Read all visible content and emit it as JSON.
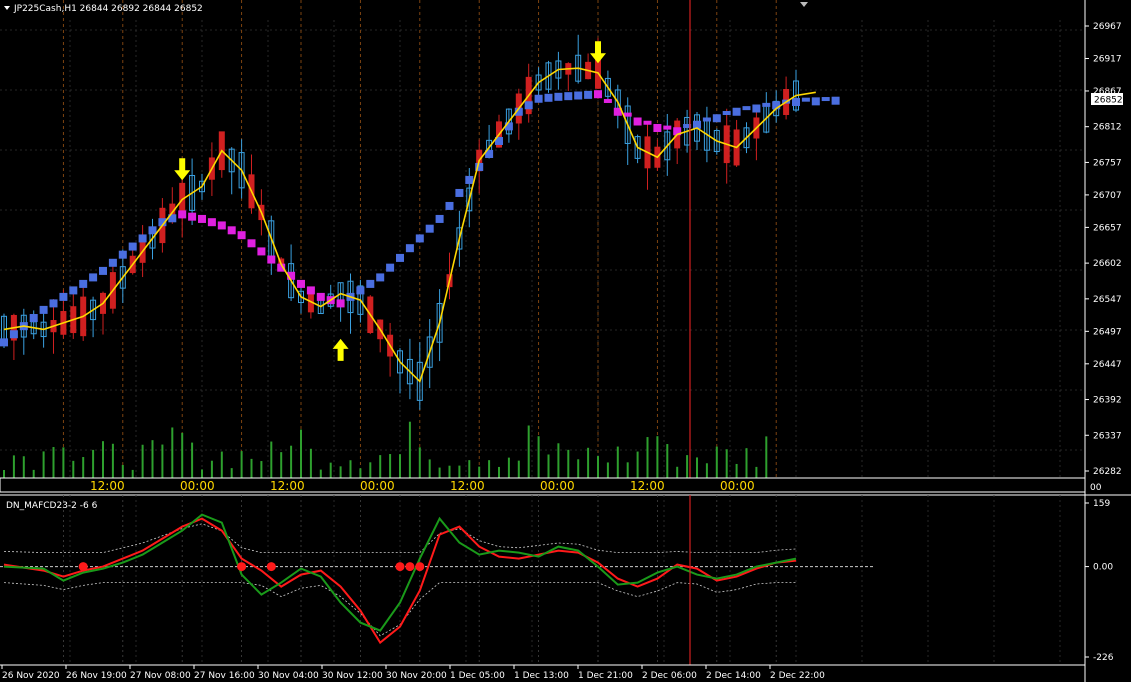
{
  "window": {
    "symbol_title": "JP225Cash,H1",
    "ohlc": "26844 26892 26844 26852",
    "indicator_title": "DN_MAFCD23-2 -6 6"
  },
  "colors": {
    "background": "#000000",
    "bull_candle": "#3aa0e0",
    "bear_candle": "#d02020",
    "volume": "#2ea02e",
    "trend_up": "#4a6ee0",
    "trend_down": "#e020e0",
    "fast_ma": "#ffd800",
    "signal_arrow": "#ffff00",
    "cursor_line": "#d02020",
    "osc_red": "#ff1a1a",
    "osc_green": "#1a9a1a"
  },
  "chart_data": [
    {
      "type": "candlestick",
      "symbol": "JP225Cash",
      "timeframe": "H1",
      "ylim": [
        26282,
        26967
      ],
      "y_ticks": [
        26967,
        26917,
        26867,
        26812,
        26757,
        26707,
        26657,
        26602,
        26547,
        26497,
        26447,
        26392,
        26337,
        26282
      ],
      "current_price": 26852,
      "session_labels": [
        "12:00",
        "00:00",
        "12:00",
        "00:00",
        "12:00",
        "00:00",
        "12:00",
        "00:00"
      ],
      "trend_line": [
        [
          0,
          26480
        ],
        [
          2,
          26505
        ],
        [
          4,
          26530
        ],
        [
          6,
          26550
        ],
        [
          8,
          26570
        ],
        [
          10,
          26590
        ],
        [
          12,
          26615
        ],
        [
          14,
          26640
        ],
        [
          16,
          26665
        ],
        [
          18,
          26677
        ],
        [
          20,
          26670
        ],
        [
          22,
          26660
        ],
        [
          24,
          26645
        ],
        [
          26,
          26620
        ],
        [
          28,
          26595
        ],
        [
          30,
          26570
        ],
        [
          32,
          26550
        ],
        [
          34,
          26540
        ],
        [
          36,
          26560
        ],
        [
          38,
          26580
        ],
        [
          40,
          26610
        ],
        [
          42,
          26640
        ],
        [
          44,
          26670
        ],
        [
          46,
          26710
        ],
        [
          48,
          26750
        ],
        [
          50,
          26790
        ],
        [
          52,
          26835
        ],
        [
          54,
          26855
        ],
        [
          56,
          26858
        ],
        [
          58,
          26860
        ],
        [
          60,
          26862
        ],
        [
          62,
          26835
        ],
        [
          64,
          26820
        ],
        [
          66,
          26810
        ],
        [
          68,
          26805
        ],
        [
          70,
          26815
        ],
        [
          72,
          26825
        ],
        [
          74,
          26835
        ],
        [
          76,
          26840
        ],
        [
          78,
          26845
        ],
        [
          80,
          26850
        ],
        [
          84,
          26852
        ]
      ],
      "fast_ma": [
        [
          0,
          26500
        ],
        [
          2,
          26505
        ],
        [
          4,
          26500
        ],
        [
          6,
          26510
        ],
        [
          8,
          26520
        ],
        [
          10,
          26540
        ],
        [
          12,
          26580
        ],
        [
          14,
          26620
        ],
        [
          16,
          26660
        ],
        [
          18,
          26700
        ],
        [
          20,
          26720
        ],
        [
          22,
          26775
        ],
        [
          24,
          26745
        ],
        [
          26,
          26680
        ],
        [
          28,
          26600
        ],
        [
          30,
          26550
        ],
        [
          32,
          26535
        ],
        [
          34,
          26555
        ],
        [
          36,
          26545
        ],
        [
          38,
          26500
        ],
        [
          40,
          26450
        ],
        [
          42,
          26420
        ],
        [
          44,
          26510
        ],
        [
          46,
          26640
        ],
        [
          48,
          26760
        ],
        [
          50,
          26800
        ],
        [
          52,
          26840
        ],
        [
          54,
          26880
        ],
        [
          56,
          26900
        ],
        [
          58,
          26902
        ],
        [
          60,
          26895
        ],
        [
          62,
          26850
        ],
        [
          64,
          26780
        ],
        [
          66,
          26765
        ],
        [
          68,
          26800
        ],
        [
          70,
          26810
        ],
        [
          72,
          26790
        ],
        [
          74,
          26780
        ],
        [
          76,
          26810
        ],
        [
          78,
          26840
        ],
        [
          80,
          26860
        ],
        [
          82,
          26865
        ]
      ],
      "signals": [
        {
          "type": "down",
          "index": 18,
          "value": 26745
        },
        {
          "type": "up",
          "index": 34,
          "value": 26470
        },
        {
          "type": "down",
          "index": 60,
          "value": 26925
        }
      ]
    },
    {
      "type": "line",
      "name": "DN_MAFCD23-2",
      "ylim": [
        -226,
        159
      ],
      "y_ticks": [
        159,
        0.0,
        -226
      ],
      "y_tick_labels": [
        "159",
        "0.00",
        "-226"
      ],
      "x_labels": [
        "26 Nov 2020",
        "26 Nov 19:00",
        "27 Nov 08:00",
        "27 Nov 16:00",
        "30 Nov 04:00",
        "30 Nov 12:00",
        "30 Nov 20:00",
        "1 Dec 05:00",
        "1 Dec 13:00",
        "1 Dec 21:00",
        "2 Dec 06:00",
        "2 Dec 14:00",
        "2 Dec 22:00"
      ],
      "series": [
        {
          "values": [
            [
              0,
              5
            ],
            [
              4,
              -10
            ],
            [
              6,
              -25
            ],
            [
              8,
              -10
            ],
            [
              10,
              0
            ],
            [
              12,
              20
            ],
            [
              14,
              40
            ],
            [
              16,
              70
            ],
            [
              18,
              100
            ],
            [
              20,
              120
            ],
            [
              22,
              90
            ],
            [
              24,
              20
            ],
            [
              26,
              -10
            ],
            [
              28,
              -50
            ],
            [
              30,
              -20
            ],
            [
              32,
              -10
            ],
            [
              34,
              -50
            ],
            [
              36,
              -110
            ],
            [
              38,
              -190
            ],
            [
              40,
              -150
            ],
            [
              42,
              -60
            ],
            [
              44,
              80
            ],
            [
              46,
              100
            ],
            [
              48,
              50
            ],
            [
              50,
              25
            ],
            [
              52,
              20
            ],
            [
              54,
              30
            ],
            [
              56,
              40
            ],
            [
              58,
              35
            ],
            [
              60,
              10
            ],
            [
              62,
              -30
            ],
            [
              64,
              -50
            ],
            [
              66,
              -30
            ],
            [
              68,
              5
            ],
            [
              70,
              -5
            ],
            [
              72,
              -35
            ],
            [
              74,
              -25
            ],
            [
              76,
              -5
            ],
            [
              78,
              10
            ],
            [
              80,
              15
            ]
          ]
        },
        {
          "values": [
            [
              0,
              0
            ],
            [
              4,
              -5
            ],
            [
              6,
              -35
            ],
            [
              8,
              -15
            ],
            [
              10,
              -5
            ],
            [
              12,
              10
            ],
            [
              14,
              30
            ],
            [
              16,
              60
            ],
            [
              18,
              90
            ],
            [
              20,
              130
            ],
            [
              22,
              110
            ],
            [
              24,
              -20
            ],
            [
              26,
              -70
            ],
            [
              28,
              -40
            ],
            [
              30,
              -5
            ],
            [
              32,
              -25
            ],
            [
              34,
              -90
            ],
            [
              36,
              -140
            ],
            [
              38,
              -160
            ],
            [
              40,
              -90
            ],
            [
              42,
              20
            ],
            [
              44,
              120
            ],
            [
              46,
              60
            ],
            [
              48,
              30
            ],
            [
              50,
              40
            ],
            [
              52,
              35
            ],
            [
              54,
              25
            ],
            [
              56,
              50
            ],
            [
              58,
              40
            ],
            [
              60,
              0
            ],
            [
              62,
              -45
            ],
            [
              64,
              -40
            ],
            [
              66,
              -15
            ],
            [
              68,
              0
            ],
            [
              70,
              -20
            ],
            [
              72,
              -30
            ],
            [
              74,
              -20
            ],
            [
              76,
              0
            ],
            [
              78,
              10
            ],
            [
              80,
              20
            ]
          ]
        }
      ]
    }
  ]
}
